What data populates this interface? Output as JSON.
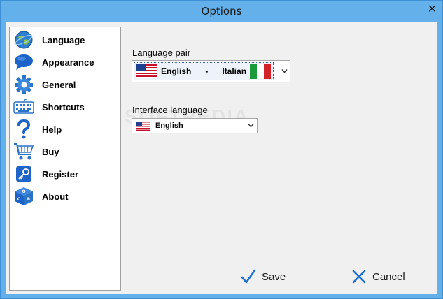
{
  "window": {
    "title": "Options",
    "close_glyph": "✕"
  },
  "sidebar": {
    "items": [
      {
        "label": "Language",
        "icon": "globe-icon"
      },
      {
        "label": "Appearance",
        "icon": "speech-bubble-icon"
      },
      {
        "label": "General",
        "icon": "gear-icon"
      },
      {
        "label": "Shortcuts",
        "icon": "keyboard-icon"
      },
      {
        "label": "Help",
        "icon": "question-icon"
      },
      {
        "label": "Buy",
        "icon": "cart-icon"
      },
      {
        "label": "Register",
        "icon": "key-icon"
      },
      {
        "label": "About",
        "icon": "cube-icon"
      }
    ]
  },
  "language_pair": {
    "label": "Language pair",
    "source": "English",
    "separator": "-",
    "target": "Italian"
  },
  "interface_language": {
    "label": "Interface language",
    "value": "English"
  },
  "buttons": {
    "save": "Save",
    "cancel": "Cancel"
  },
  "colors": {
    "accent": "#1a6fd0",
    "titlebar": "#64b0ea"
  }
}
